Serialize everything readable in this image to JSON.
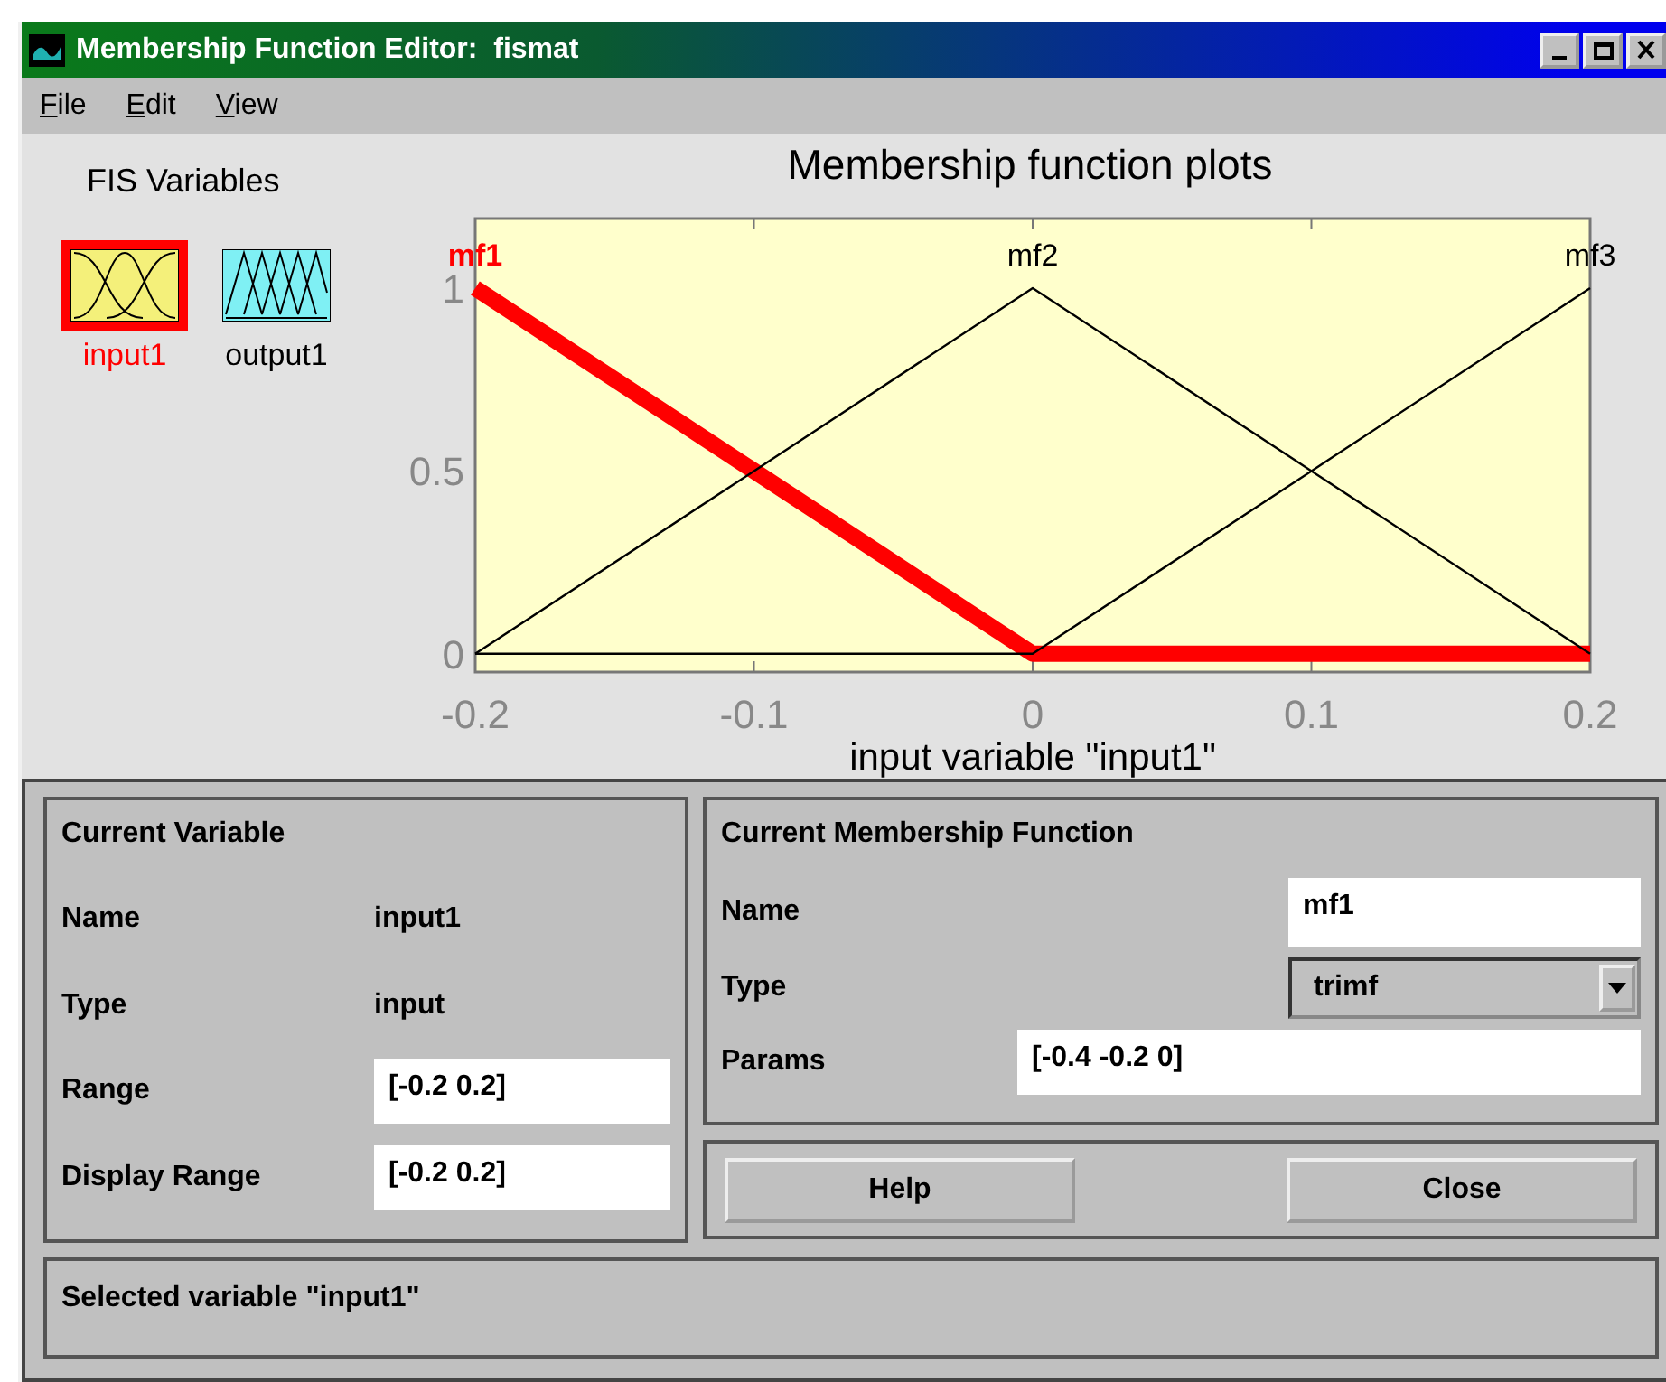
{
  "window": {
    "title": "Membership Function Editor:  fismat"
  },
  "menu": [
    "File",
    "Edit",
    "View"
  ],
  "fis_variables": {
    "title": "FIS Variables",
    "items": [
      {
        "label": "input1",
        "kind": "input",
        "selected": true
      },
      {
        "label": "output1",
        "kind": "output",
        "selected": false
      }
    ]
  },
  "plot": {
    "chart_data": {
      "type": "line",
      "title": "Membership function plots",
      "xlabel": "input variable \"input1\"",
      "x": [
        -0.2,
        -0.1,
        0,
        0.1,
        0.2
      ],
      "xlim": [
        -0.2,
        0.2
      ],
      "ylim": [
        -0.05,
        1.19
      ],
      "xticks": [
        -0.2,
        -0.1,
        0,
        0.1,
        0.2
      ],
      "yticks": [
        0,
        0.5,
        1
      ],
      "series": [
        {
          "name": "mf1",
          "color": "#ff0000",
          "values": [
            1,
            0.5,
            0,
            0,
            0
          ]
        },
        {
          "name": "mf2",
          "color": "#000000",
          "values": [
            0,
            0.5,
            1,
            0.5,
            0
          ]
        },
        {
          "name": "mf3",
          "color": "#000000",
          "values": [
            0,
            0,
            0,
            0.5,
            1
          ]
        }
      ]
    },
    "curves": [
      {
        "selected": true
      },
      {
        "selected": false
      },
      {
        "selected": false
      }
    ]
  },
  "current_variable": {
    "title": "Current Variable",
    "rows": [
      {
        "label": "Name",
        "kind": "text",
        "value": "input1"
      },
      {
        "label": "Type",
        "kind": "text",
        "value": "input"
      },
      {
        "label": "Range",
        "kind": "field",
        "value": "[-0.2 0.2]"
      },
      {
        "label": "Display Range",
        "kind": "field",
        "value": "[-0.2 0.2]"
      }
    ]
  },
  "current_mf": {
    "title": "Current Membership Function",
    "name_label": "Name",
    "name": "mf1",
    "type_label": "Type",
    "type": "trimf",
    "params_label": "Params",
    "params": "[-0.4 -0.2 0]"
  },
  "buttons": [
    "Help",
    "Close"
  ],
  "status": "Selected variable \"input1\""
}
